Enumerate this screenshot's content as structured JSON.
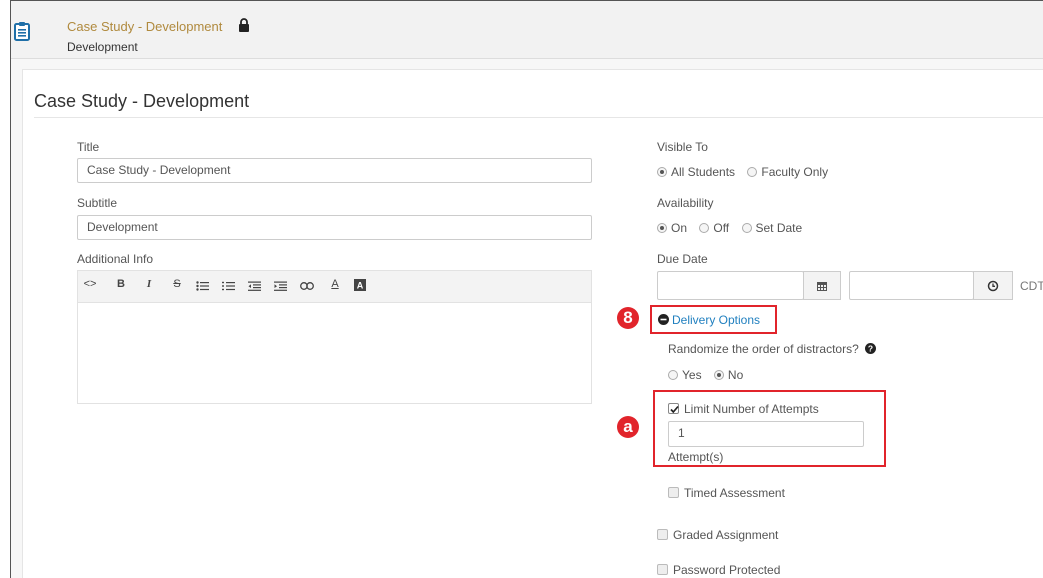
{
  "header": {
    "title": "Case Study - Development",
    "subtitle": "Development",
    "icon": "clipboard-icon",
    "lock_icon": "lock-icon"
  },
  "page": {
    "title": "Case Study - Development"
  },
  "form": {
    "title_label": "Title",
    "title_value": "Case Study - Development",
    "subtitle_label": "Subtitle",
    "subtitle_value": "Development",
    "additional_info_label": "Additional Info",
    "toolbar_buttons": [
      "code",
      "bold",
      "italic",
      "strikethrough",
      "bullet-list",
      "numbered-list",
      "outdent",
      "indent",
      "link",
      "text-color",
      "background-color"
    ],
    "visible_to_label": "Visible To",
    "visible_to_options": [
      "All Students",
      "Faculty Only"
    ],
    "visible_to_selected": "All Students",
    "availability_label": "Availability",
    "availability_options": [
      "On",
      "Off",
      "Set Date"
    ],
    "availability_selected": "On",
    "due_date_label": "Due Date",
    "due_date_value": "",
    "due_time_value": "",
    "timezone": "CDT",
    "delivery_options_label": "Delivery Options",
    "randomize_label": "Randomize the order of distractors?",
    "randomize_options": [
      "Yes",
      "No"
    ],
    "randomize_selected": "No",
    "limit_attempts_label": "Limit Number of Attempts",
    "limit_attempts_checked": true,
    "attempts_value": "1",
    "attempts_unit": "Attempt(s)",
    "timed_label": "Timed Assessment",
    "graded_label": "Graded Assignment",
    "password_label": "Password Protected"
  },
  "annotations": {
    "step_badge": "8",
    "sub_badge": "a",
    "color": "#e1242b"
  },
  "colors": {
    "header_title": "#b08a3e",
    "link": "#1f7fbf"
  }
}
